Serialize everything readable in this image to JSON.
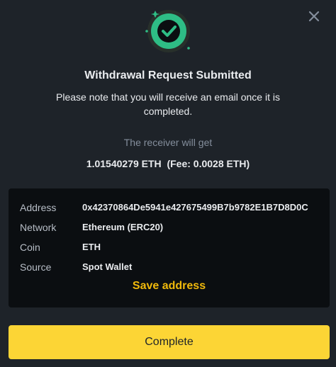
{
  "dialog": {
    "title": "Withdrawal Request Submitted",
    "subtitle": "Please note that you will receive an email once it is completed.",
    "receiver_label": "The receiver will get",
    "amount": "1.01540279 ETH",
    "fee": "(Fee: 0.0028 ETH)"
  },
  "details": {
    "address_label": "Address",
    "address_value": "0x42370864De5941e427675499B7b9782E1B7D8D0C",
    "network_label": "Network",
    "network_value": "Ethereum (ERC20)",
    "coin_label": "Coin",
    "coin_value": "ETH",
    "source_label": "Source",
    "source_value": "Spot Wallet",
    "save_label": "Save address"
  },
  "actions": {
    "complete_label": "Complete"
  },
  "icons": {
    "close": "close-icon",
    "success": "check-circle-icon"
  },
  "colors": {
    "background": "#1e2329",
    "card": "#0b0e11",
    "accent_yellow": "#fcd535",
    "link_yellow": "#f0b90b",
    "success_green": "#2ebd85"
  }
}
